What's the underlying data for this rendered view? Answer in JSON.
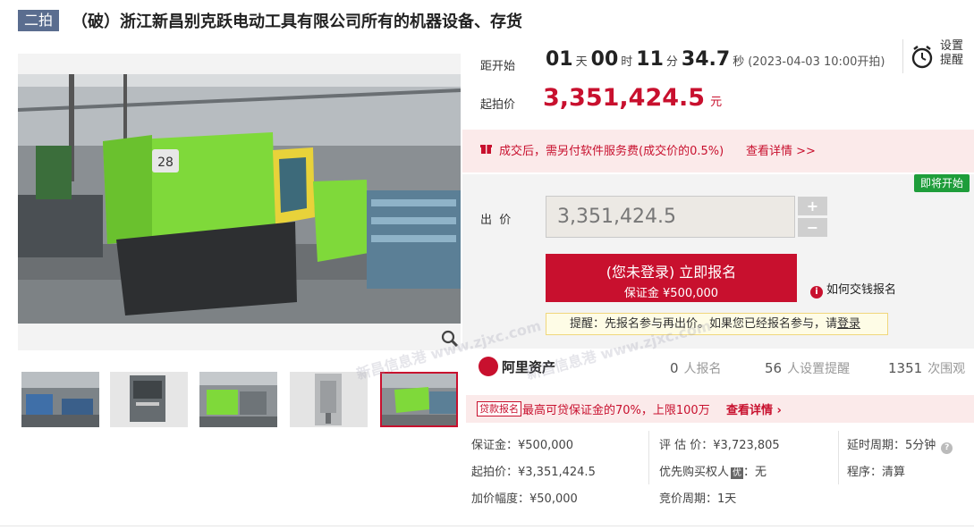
{
  "header": {
    "round_badge": "二拍",
    "title": "（破）浙江新昌别克跃电动工具有限公司所有的机器设备、存货"
  },
  "gallery": {
    "main_image_alt": "",
    "machine_number": "28",
    "thumb_count": 5,
    "active_thumb_index": 4
  },
  "countdown": {
    "label": "距开始",
    "days": "01",
    "days_unit": "天",
    "hours": "00",
    "hours_unit": "时",
    "minutes": "11",
    "minutes_unit": "分",
    "seconds": "34.7",
    "seconds_unit": "秒",
    "start_note": "(2023-04-03 10:00开拍)"
  },
  "reminder_setting": {
    "line1": "设置",
    "line2": "提醒"
  },
  "start_price": {
    "label": "起拍价",
    "value": "3,351,424.5",
    "unit": "元"
  },
  "fee_notice": {
    "text": "成交后，需另付软件服务费(成交价的0.5%)",
    "link": "查看详情 >>"
  },
  "bid": {
    "soon_badge": "即将开始",
    "label": "出  价",
    "value": "3,351,424.5",
    "plus": "+",
    "minus": "−",
    "register_line1": "(您未登录) 立即报名",
    "register_line2": "保证金 ¥500,000",
    "how_pay": "如何交钱报名",
    "reminder_text": "提醒：先报名参与再出价。如果您已经报名参与，请",
    "reminder_link": "登录"
  },
  "stats": {
    "brand": "阿里资产",
    "signups": "0",
    "signups_label": "人报名",
    "reminders": "56",
    "reminders_label": "人设置提醒",
    "views": "1351",
    "views_label": "次围观"
  },
  "promo": {
    "tag": "贷款报名",
    "text": "最高可贷保证金的70%，上限100万",
    "link": "查看详情"
  },
  "info": {
    "deposit": "保证金：¥500,000",
    "start_price": "起拍价：¥3,351,424.5",
    "increment": "加价幅度：¥50,000",
    "appraisal": "评 估 价：¥3,723,805",
    "priority_label": "优先购买权人",
    "priority_tag": "优",
    "priority_value": "：无",
    "bid_cycle": "竞价周期：1天",
    "delay_cycle": "延时周期：5分钟",
    "procedure": "程序：清算"
  },
  "watermark": {
    "text": "新昌信息港 www.zjxc.com"
  },
  "colors": {
    "accent": "#c8102e",
    "badge_blue": "#5a6d8f",
    "soon_green": "#1e9d3a"
  }
}
